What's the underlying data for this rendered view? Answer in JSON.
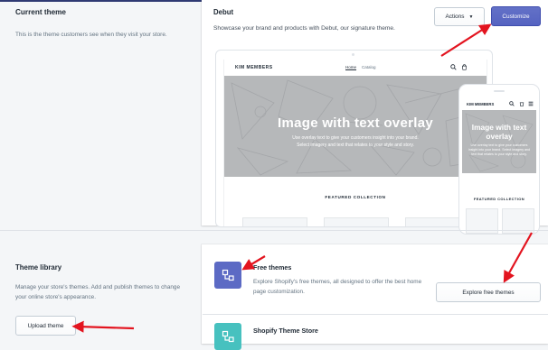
{
  "current_theme": {
    "section_title": "Current theme",
    "section_description": "This is the theme customers see when they visit your store.",
    "theme_name": "Debut",
    "theme_description": "Showcase your brand and products with Debut, our signature theme.",
    "actions_label": "Actions",
    "customize_label": "Customize"
  },
  "preview": {
    "brand": "KIM MEMBERS",
    "nav_links": [
      "Home",
      "Catalog"
    ],
    "hero_title": "Image with text overlay",
    "hero_subtitle": "Use overlay text to give your customers insight into your brand. Select imagery and text that relates to your style and story.",
    "featured_label": "FEATURED COLLECTION",
    "mobile_brand": "KIM MEMBERS",
    "mobile_hero_title": "Image with text overlay",
    "mobile_hero_subtitle": "Use overlay text to give your customers insight into your brand. Select imagery and text that relates to your style and story.",
    "mobile_featured_label": "FEATURED COLLECTION"
  },
  "theme_library": {
    "section_title": "Theme library",
    "section_description": "Manage your store's themes. Add and publish themes to change your online store's appearance.",
    "upload_label": "Upload theme",
    "free_themes": {
      "title": "Free themes",
      "description": "Explore Shopify's free themes, all designed to offer the best home page customization.",
      "button_label": "Explore free themes",
      "icon": "theme-icon"
    },
    "theme_store": {
      "title": "Shopify Theme Store",
      "icon": "theme-store-icon"
    }
  },
  "colors": {
    "primary": "#5c6ac4",
    "teal": "#47c1bf",
    "annotation_arrow": "#e3141f"
  }
}
